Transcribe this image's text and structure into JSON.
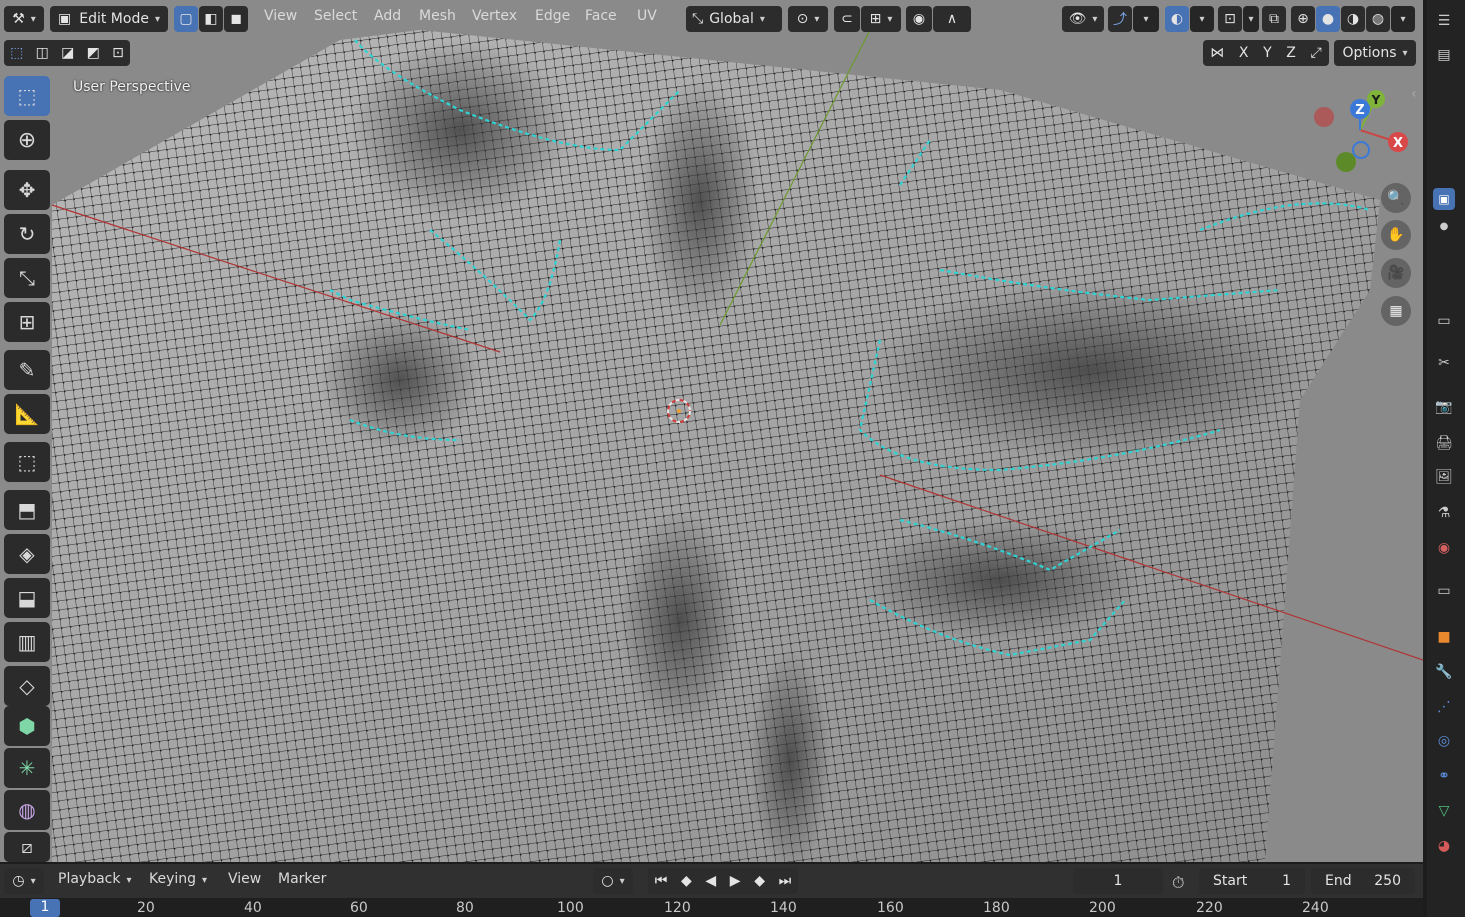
{
  "header": {
    "mode_label": "Edit Mode",
    "menus": [
      "View",
      "Select",
      "Add",
      "Mesh",
      "Vertex",
      "Edge",
      "Face",
      "UV"
    ],
    "transform_orientation": "Global",
    "options_label": "Options",
    "axis_x": "X",
    "axis_y": "Y",
    "axis_z": "Z"
  },
  "viewport": {
    "view_label": "User Perspective"
  },
  "gizmo": {
    "x_label": "X",
    "y_label": "Y",
    "z_label": "Z"
  },
  "timeline": {
    "playback_label": "Playback",
    "keying_label": "Keying",
    "view_label": "View",
    "marker_label": "Marker",
    "current_frame": "1",
    "start_label": "Start",
    "start_value": "1",
    "end_label": "End",
    "end_value": "250"
  },
  "ruler": {
    "current": "1",
    "ticks": [
      "20",
      "40",
      "60",
      "80",
      "100",
      "120",
      "140",
      "160",
      "180",
      "200",
      "220",
      "240"
    ]
  },
  "colors": {
    "accent": "#4772b3",
    "viewport_bg": "#8a8a8a",
    "panel": "#2c2c2c",
    "seam": "#2fd3d3",
    "axis_x": "#e04a4a",
    "axis_y": "#7fb33a"
  }
}
